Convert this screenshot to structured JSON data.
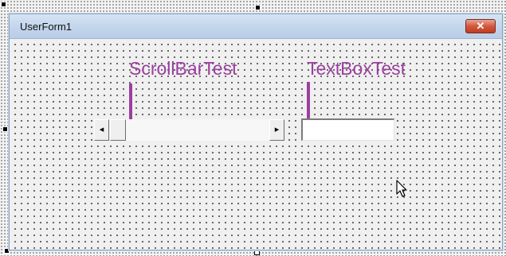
{
  "form": {
    "title": "UserForm1",
    "close_glyph": "✕"
  },
  "annotations": {
    "scrollbar_label": "ScrollBarTest",
    "textbox_label": "TextBoxTest",
    "color": "#9b3fa0"
  },
  "scrollbar": {
    "left_arrow": "◂",
    "right_arrow": "▸"
  },
  "textbox": {
    "value": ""
  },
  "icons": {
    "cursor": "mouse-pointer-icon"
  }
}
